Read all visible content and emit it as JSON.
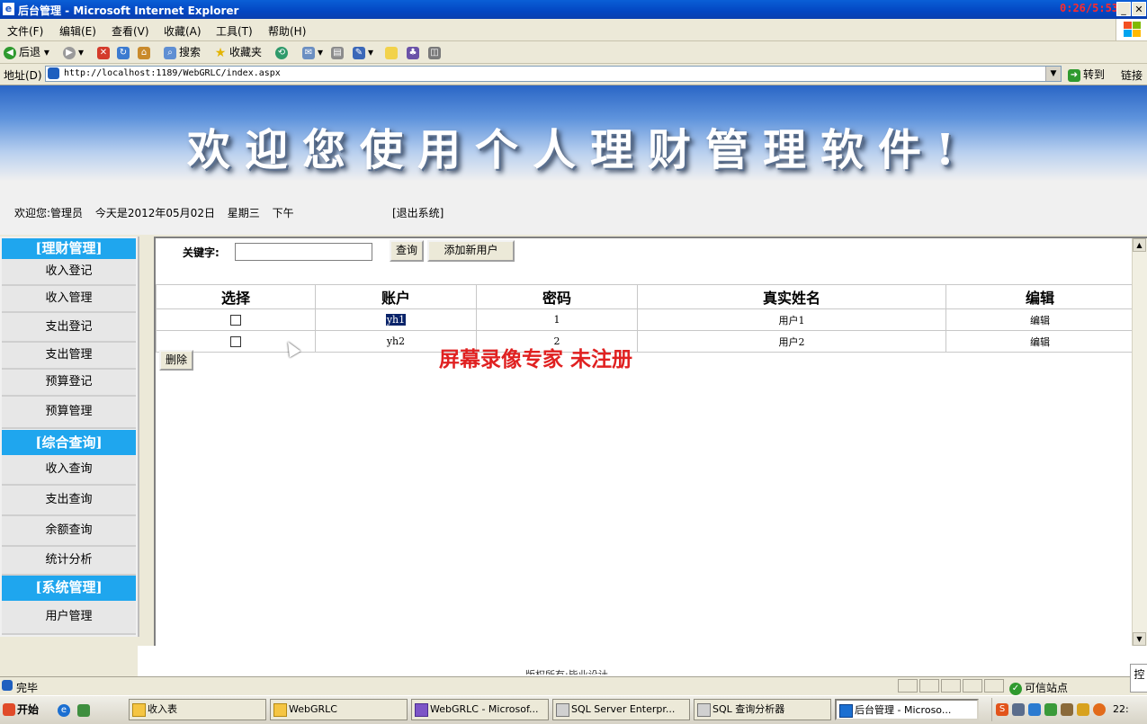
{
  "window": {
    "title": "后台管理 - Microsoft Internet Explorer",
    "app_icon": "ie-icon",
    "recorder_timer": "0:26/5:53",
    "controls": {
      "minimize": "_",
      "maximize": "□",
      "close": "✕"
    }
  },
  "menu": [
    "文件(F)",
    "编辑(E)",
    "查看(V)",
    "收藏(A)",
    "工具(T)",
    "帮助(H)"
  ],
  "toolbar": {
    "back": "后退",
    "search": "搜索",
    "favorites": "收藏夹"
  },
  "address": {
    "label": "地址(D)",
    "url": "http://localhost:1189/WebGRLC/index.aspx",
    "go": "转到",
    "links": "链接"
  },
  "banner": {
    "title": "欢迎您使用个人理财管理软件!",
    "welcome_user": "欢迎您:管理员",
    "today": "今天是2012年05月02日",
    "weekday": "星期三",
    "period": "下午",
    "logout": "[退出系统]"
  },
  "sidebar": {
    "sections": [
      {
        "title": "[理财管理]",
        "items": [
          "收入登记",
          "收入管理",
          "支出登记",
          "支出管理",
          "预算登记",
          "预算管理"
        ]
      },
      {
        "title": "[综合查询]",
        "items": [
          "收入查询",
          "支出查询",
          "余额查询",
          "统计分析"
        ]
      },
      {
        "title": "[系统管理]",
        "items": [
          "用户管理"
        ]
      }
    ]
  },
  "search": {
    "label": "关键字:",
    "value": "",
    "query_button": "查询",
    "add_button": "添加新用户"
  },
  "table": {
    "headers": [
      "选择",
      "账户",
      "密码",
      "真实姓名",
      "编辑"
    ],
    "rows": [
      {
        "account": "yh1",
        "password": "1",
        "real_name": "用户1",
        "edit": "编辑",
        "checked": false
      },
      {
        "account": "yh2",
        "password": "2",
        "real_name": "用户2",
        "edit": "编辑",
        "checked": false
      }
    ],
    "delete_button": "删除"
  },
  "watermark": "屏幕录像专家  未注册",
  "footer": "版权所有:毕业设计",
  "status": {
    "text": "完毕",
    "zone": "可信站点"
  },
  "taskbar": {
    "start": "开始",
    "tasks": [
      "收入表",
      "WebGRLC",
      "WebGRLC - Microsof...",
      "SQL Server Enterpr...",
      "SQL 查询分析器",
      "后台管理 - Microso..."
    ],
    "active_task": 5,
    "clock": "22:",
    "popup": "控"
  },
  "colors": {
    "section_header": "#1fa6ee",
    "title_bar": "#0a5fd6",
    "watermark": "#e02121"
  }
}
